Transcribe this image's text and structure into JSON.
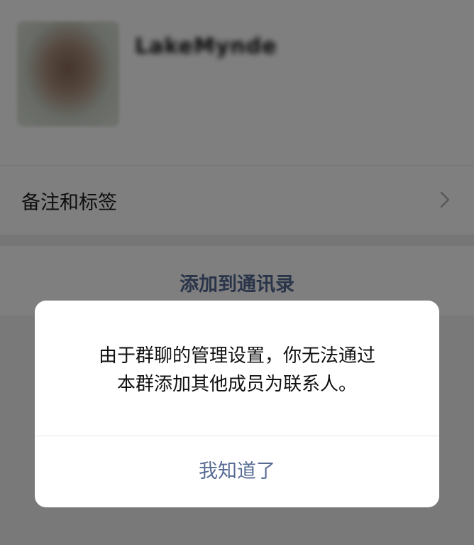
{
  "profile": {
    "nickname": "LakeMynde"
  },
  "remark_row": {
    "label": "备注和标签"
  },
  "add_contact": {
    "label": "添加到通讯录"
  },
  "dialog": {
    "message_line1": "由于群聊的管理设置，你无法通过",
    "message_line2": "本群添加其他成员为联系人。",
    "confirm_label": "我知道了"
  },
  "colors": {
    "link": "#576b95",
    "mask": "rgba(0,0,0,0.5)"
  }
}
